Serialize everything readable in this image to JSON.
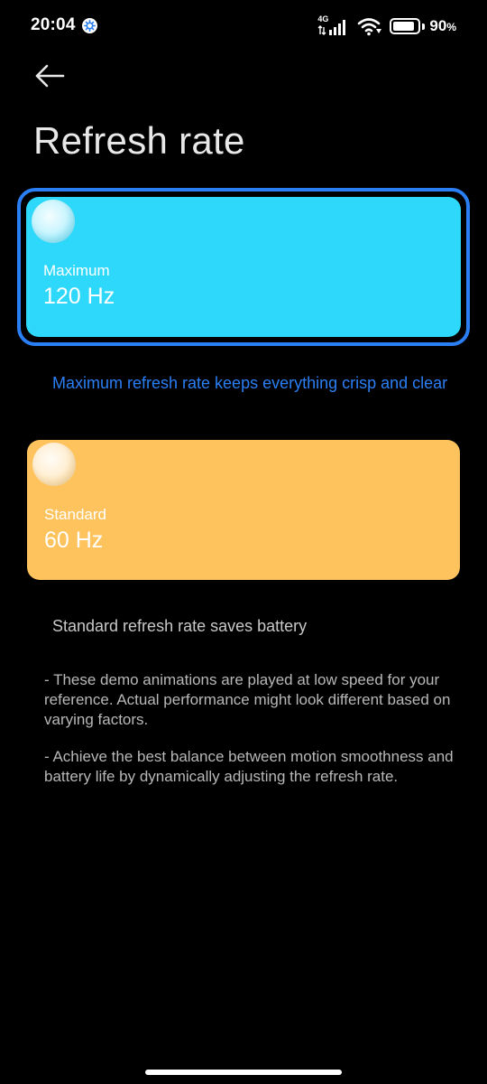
{
  "status_bar": {
    "time": "20:04",
    "network_label": "4G",
    "battery_percent": "90",
    "battery_unit": "%",
    "battery_level": 0.9,
    "icons": [
      "settings-gear-icon",
      "cellular-signal-icon",
      "wifi-icon",
      "battery-icon"
    ]
  },
  "header": {
    "back_icon": "arrow-left-icon",
    "title": "Refresh rate"
  },
  "options": [
    {
      "label": "Maximum",
      "value": "120 Hz",
      "description": "Maximum refresh rate keeps everything crisp and clear",
      "selected": true,
      "color": "#2ed8fb",
      "description_color": "#2b7ff5"
    },
    {
      "label": "Standard",
      "value": "60 Hz",
      "description": "Standard refresh rate saves battery",
      "selected": false,
      "color": "#fec35c",
      "description_color": "#c8c8c8"
    }
  ],
  "notes": [
    "- These demo animations are played at low speed for your reference. Actual performance might look different based on varying factors.",
    "- Achieve the best balance between motion smoothness and battery life by dynamically adjusting the refresh rate."
  ],
  "colors": {
    "accent": "#2b7ff5",
    "background": "#000000"
  }
}
